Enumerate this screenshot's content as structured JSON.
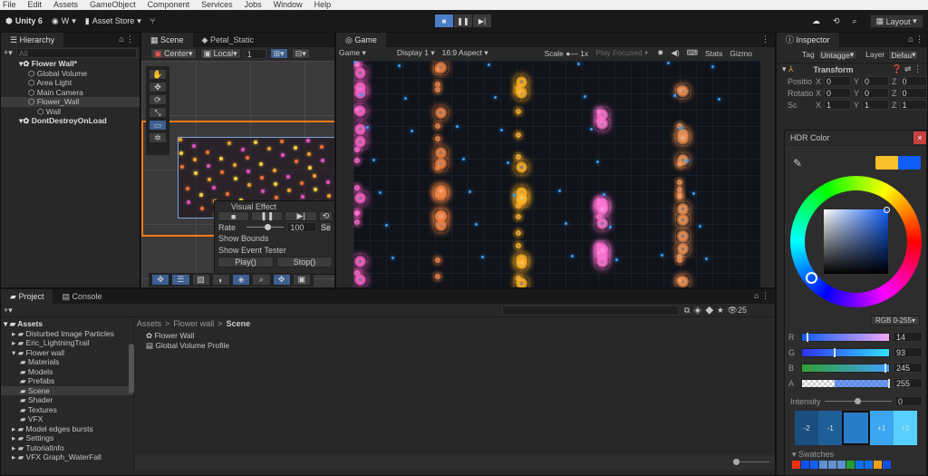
{
  "menu": [
    "File",
    "Edit",
    "Assets",
    "GameObject",
    "Component",
    "Services",
    "Jobs",
    "Window",
    "Help"
  ],
  "toolbar": {
    "app": "Unity 6",
    "account": "W",
    "asset_store": "Asset Store",
    "layout": "Layout"
  },
  "hierarchy": {
    "title": "Hierarchy",
    "search_placeholder": "All",
    "items": [
      {
        "label": "Flower Wall*",
        "depth": 0
      },
      {
        "label": "Global Volume",
        "depth": 1
      },
      {
        "label": "Area Light",
        "depth": 1
      },
      {
        "label": "Main Camera",
        "depth": 1
      },
      {
        "label": "Flower_Wall",
        "depth": 1
      },
      {
        "label": "Wall",
        "depth": 2
      },
      {
        "label": "DontDestroyOnLoad",
        "depth": 0
      }
    ]
  },
  "scene": {
    "tabs": [
      "Scene",
      "Petal_Static"
    ],
    "pivot": "Center",
    "space": "Local",
    "grid_value": "1",
    "visual_effect": {
      "title": "Visual Effect",
      "rate_label": "Rate",
      "rate_value": "100",
      "set_label": "Se",
      "rate_fraction": 0.5,
      "show_bounds": "Show Bounds",
      "show_event_tester": "Show Event Tester",
      "play": "Play()",
      "stop": "Stop()"
    }
  },
  "game": {
    "tab": "Game",
    "mode": "Game",
    "display": "Display 1",
    "aspect": "16:9 Aspect",
    "scale_label": "Scale",
    "scale_value": "1x",
    "play_focused": "Play Focused",
    "stats": "Stats",
    "gizmos": "Gizmo"
  },
  "inspector": {
    "title": "Inspector",
    "tag_label": "Tag",
    "tag_value": "Untagge",
    "layer_label": "Layer",
    "layer_value": "Defau",
    "transform": "Transform",
    "rows": [
      {
        "label": "Positio",
        "x": "0",
        "y": "0",
        "z": "0"
      },
      {
        "label": "Rotatio",
        "x": "0",
        "y": "0",
        "z": "0"
      },
      {
        "label": "Sc",
        "x": "1",
        "y": "1",
        "z": "1"
      }
    ]
  },
  "hdr": {
    "title": "HDR Color",
    "mode": "RGB 0-255",
    "channels": [
      {
        "label": "R",
        "value": "14",
        "fraction": 0.055
      },
      {
        "label": "G",
        "value": "93",
        "fraction": 0.365
      },
      {
        "label": "B",
        "value": "245",
        "fraction": 0.96
      },
      {
        "label": "A",
        "value": "255",
        "fraction": 1.0
      }
    ],
    "intensity_label": "Intensity",
    "intensity_value": "0",
    "stops": [
      "-2",
      "-1",
      "",
      "+1",
      "+2"
    ],
    "swatches_label": "Swatches",
    "colors": {
      "old": "#f5c02a",
      "new": "#0e5df5"
    },
    "swatch_colors": [
      "#f03010",
      "#1050f0",
      "#1060f5",
      "#6090d0",
      "#6090d0",
      "#6090d0",
      "#20a030",
      "#1070f0",
      "#1070f0",
      "#f0a010",
      "#1050e0"
    ]
  },
  "project": {
    "tabs": [
      "Project",
      "Console"
    ],
    "tree": [
      {
        "label": "Assets",
        "depth": 0
      },
      {
        "label": "Disturbed Image Particles",
        "depth": 1
      },
      {
        "label": "Eric_LightningTrail",
        "depth": 1
      },
      {
        "label": "Flower wall",
        "depth": 1
      },
      {
        "label": "Materials",
        "depth": 2
      },
      {
        "label": "Models",
        "depth": 2
      },
      {
        "label": "Prefabs",
        "depth": 2
      },
      {
        "label": "Scene",
        "depth": 2
      },
      {
        "label": "Shader",
        "depth": 2
      },
      {
        "label": "Textures",
        "depth": 2
      },
      {
        "label": "VFX",
        "depth": 2
      },
      {
        "label": "Model edges bursts",
        "depth": 1
      },
      {
        "label": "Settings",
        "depth": 1
      },
      {
        "label": "TutorialInfo",
        "depth": 1
      },
      {
        "label": "VFX Graph_WaterFall",
        "depth": 1
      }
    ],
    "breadcrumb": [
      "Assets",
      "Flower wall",
      "Scene"
    ],
    "files": [
      "Flower Wall",
      "Global Volume Profile"
    ],
    "hidden_count": "25"
  }
}
